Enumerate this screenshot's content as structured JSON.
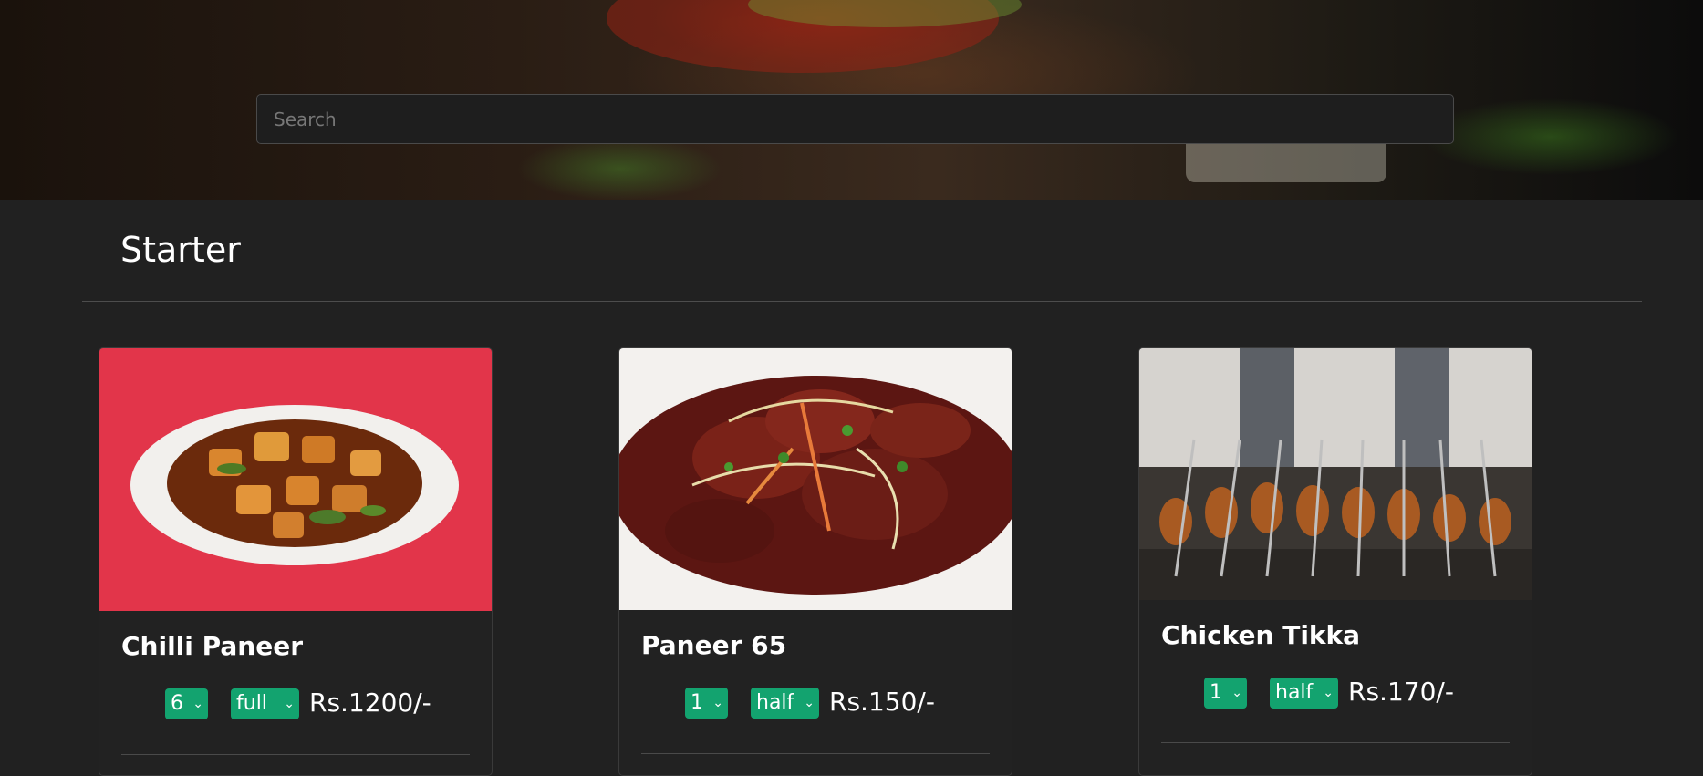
{
  "search": {
    "placeholder": "Search"
  },
  "section": {
    "title": "Starter"
  },
  "items": [
    {
      "name": "Chilli Paneer",
      "qty": "6",
      "size": "full",
      "price": "Rs.1200/-",
      "image": "chilli-paneer-photo"
    },
    {
      "name": "Paneer 65",
      "qty": "1",
      "size": "half",
      "price": "Rs.150/-",
      "image": "paneer-65-photo"
    },
    {
      "name": "Chicken Tikka",
      "qty": "1",
      "size": "half",
      "price": "Rs.170/-",
      "image": "chicken-tikka-photo"
    }
  ],
  "colors": {
    "accent": "#13a36f",
    "background": "#212121"
  },
  "icons": {
    "dropdown": "chevron-down-icon"
  }
}
